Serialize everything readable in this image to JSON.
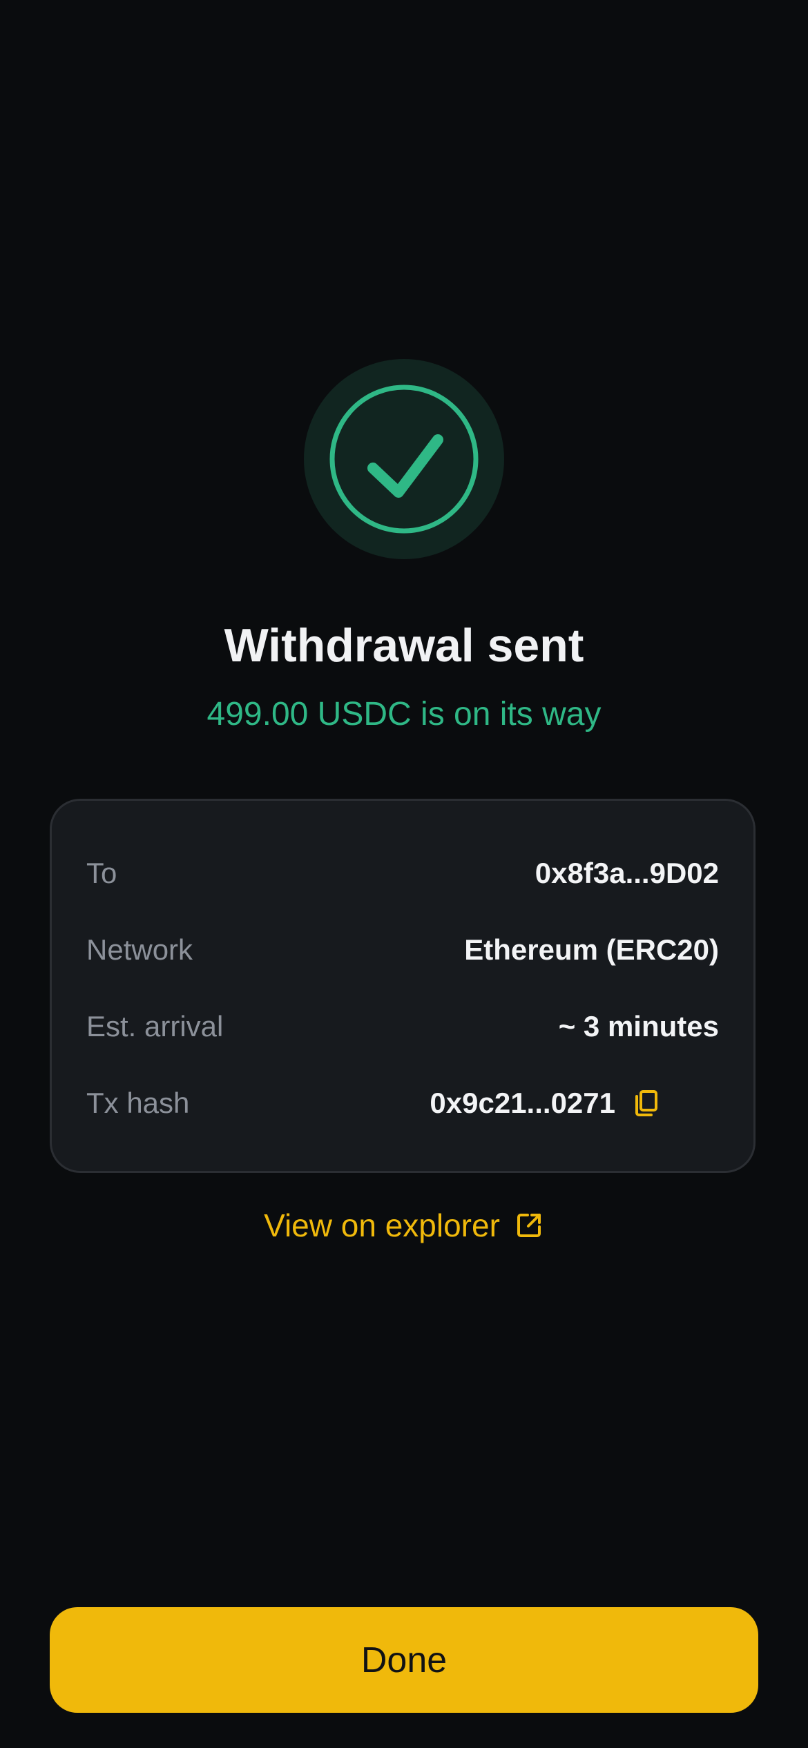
{
  "status": {
    "icon": "check-circle-icon",
    "title": "Withdrawal sent",
    "subtitle": "499.00 USDC is on its way"
  },
  "details": {
    "rows": [
      {
        "label": "To",
        "value": "0x8f3a...9D02"
      },
      {
        "label": "Network",
        "value": "Ethereum (ERC20)"
      },
      {
        "label": "Est. arrival",
        "value": "~ 3 minutes"
      },
      {
        "label": "Tx hash",
        "value": "0x9c21...0271",
        "icon": "copy-icon"
      }
    ]
  },
  "explorer": {
    "label": "View on explorer",
    "icon": "external-link-icon"
  },
  "done_button": {
    "label": "Done"
  },
  "colors": {
    "background": "#0a0c0e",
    "success": "#2fb886",
    "accent": "#f0b90b",
    "card": "#171a1e"
  }
}
